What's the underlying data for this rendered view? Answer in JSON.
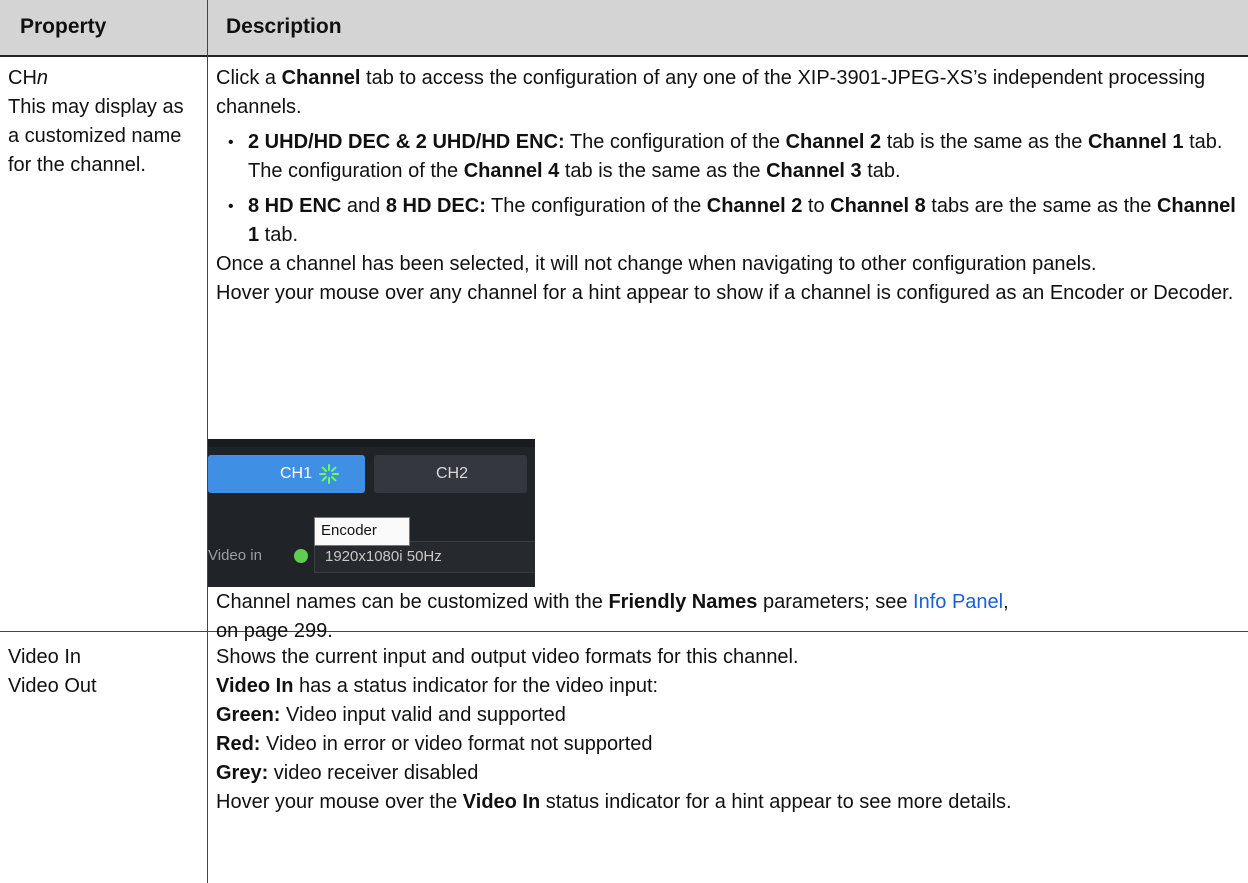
{
  "header": {
    "property": "Property",
    "description": "Description"
  },
  "rows": [
    {
      "property_lines": [
        "CH",
        "n",
        "This may display as a customized name for the channel."
      ],
      "intro_a": "Click a ",
      "intro_b": "Channel",
      "intro_c": " tab to access the configuration of any one of the XIP-3901-JPEG-XS’s independent processing channels.",
      "bullet1": {
        "a": "2 UHD/HD DEC & 2 UHD/HD ENC:",
        "b": " The configuration of the ",
        "c": "Channel 2",
        "d": " tab is the same as the ",
        "e": "Channel 1",
        "f": " tab. The configuration of the ",
        "g": "Channel 4",
        "h": " tab is the same as the ",
        "i": "Channel 3",
        "j": " tab."
      },
      "bullet2": {
        "a": "8 HD ENC",
        "b": " and ",
        "c": "8 HD DEC:",
        "d": " The configuration of the ",
        "e": "Channel 2",
        "f": " to ",
        "g": "Channel 8",
        "h": " tabs are the same as the ",
        "i": "Channel 1",
        "j": " tab."
      },
      "para1": "Once a channel has been selected, it will not change when navigating to other configuration panels.",
      "para2": "Hover your mouse over any channel for a hint appear to show if a channel is configured as an Encoder or Decoder.",
      "screenshot": {
        "tab1": "CH1",
        "tab2": "CH2",
        "tooltip": "Encoder",
        "video_in_label": "Video in",
        "video_in_value": "1920x1080i 50Hz",
        "status_color": "#5fce4f"
      },
      "friendly_a": "Channel names can be customized with the ",
      "friendly_b": "Friendly Names",
      "friendly_c": " parameters; see ",
      "friendly_link": "Info Panel",
      "friendly_d": ",",
      "friendly_e": "on page 299."
    },
    {
      "property_line1": "Video In",
      "property_line2": "Video Out",
      "l1": "Shows the current input and output video formats for this channel.",
      "l2a": "Video In",
      "l2b": " has a status indicator for the video input:",
      "l3a": "Green:",
      "l3b": " Video input valid and supported",
      "l4a": "Red:",
      "l4b": " Video in error or video format not supported",
      "l5a": "Grey:",
      "l5b": " video receiver disabled",
      "l6a": "Hover your mouse over the ",
      "l6b": "Video In",
      "l6c": " status indicator for a hint appear to see more details."
    }
  ]
}
